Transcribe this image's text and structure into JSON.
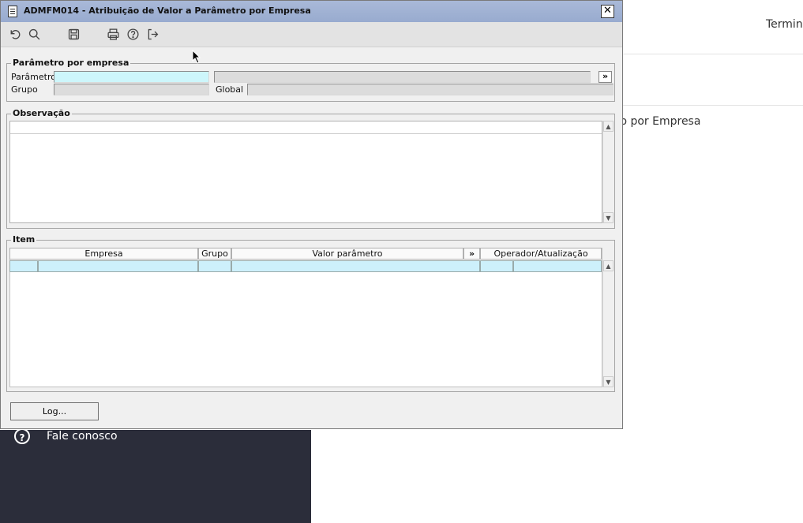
{
  "background": {
    "header_text": "Termin",
    "breadcrumb": "ro por Empresa",
    "sidebar_item": "Fale conosco",
    "help_icon_glyph": "?"
  },
  "dialog": {
    "title": "ADMFM014 - Atribuição de Valor a Parâmetro por Empresa",
    "close_label": "✕",
    "toolbar": [
      {
        "name": "undo-icon"
      },
      {
        "name": "search-icon"
      },
      {
        "name": "save-icon"
      },
      {
        "name": "print-icon"
      },
      {
        "name": "help-icon"
      },
      {
        "name": "exit-icon"
      }
    ],
    "parametro_group": {
      "legend": "Parâmetro por empresa",
      "parametro_label": "Parâmetro",
      "grupo_label": "Grupo",
      "global_label": "Global",
      "more_label": "»"
    },
    "observacao_group": {
      "legend": "Observação"
    },
    "item_group": {
      "legend": "Item",
      "columns": [
        "Empresa",
        "Grupo",
        "Valor parâmetro",
        "»",
        "Operador/Atualização"
      ]
    },
    "log_button": "Log..."
  },
  "colors": {
    "titlebar": "#a9b9d8",
    "active_field": "#cdf6fb",
    "sidebar": "#2b2d3a"
  }
}
